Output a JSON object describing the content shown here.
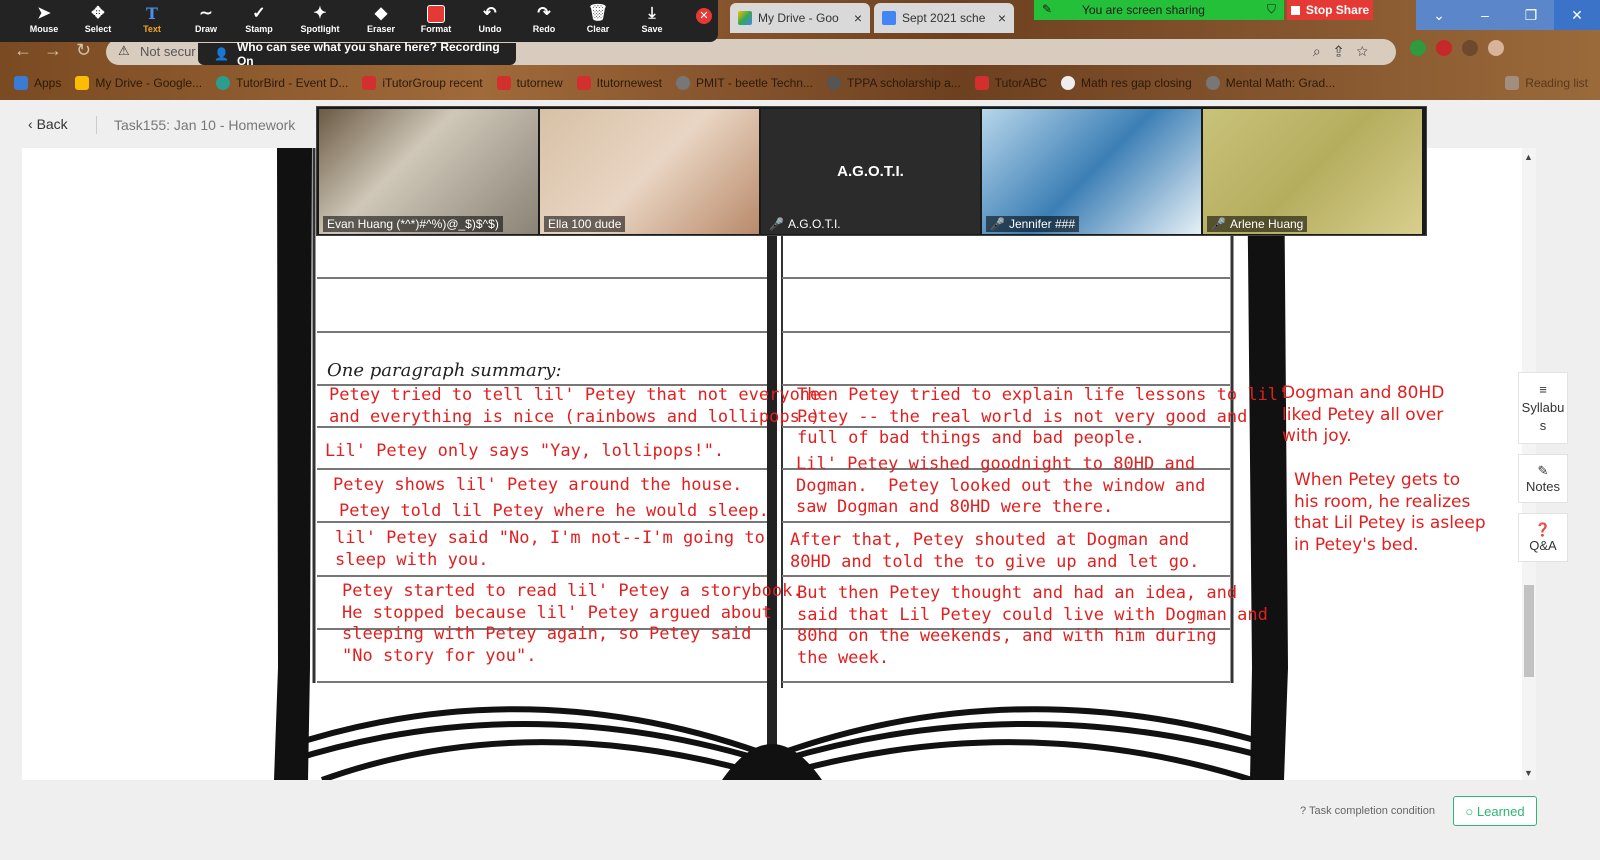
{
  "zoom_toolbar": {
    "tools": [
      {
        "label": "Mouse",
        "icon": "cursor-icon"
      },
      {
        "label": "Select",
        "icon": "move-icon"
      },
      {
        "label": "Text",
        "icon": "text-icon",
        "active": true
      },
      {
        "label": "Draw",
        "icon": "squiggle-icon"
      },
      {
        "label": "Stamp",
        "icon": "check-icon"
      },
      {
        "label": "Spotlight",
        "icon": "wand-icon"
      },
      {
        "label": "Eraser",
        "icon": "eraser-icon"
      },
      {
        "label": "Format",
        "icon": "format-swatch-icon"
      },
      {
        "label": "Undo",
        "icon": "undo-icon"
      },
      {
        "label": "Redo",
        "icon": "redo-icon"
      },
      {
        "label": "Clear",
        "icon": "trash-icon"
      },
      {
        "label": "Save",
        "icon": "save-icon"
      }
    ],
    "recording_notice": "Who can see what you share here? Recording On",
    "sharing_status": "You are screen sharing",
    "stop_share": "Stop Share"
  },
  "browser": {
    "tabs": [
      "My Drive - Goo",
      "Sept 2021 sche"
    ],
    "address_warning": "Not secur",
    "bookmarks": [
      "Apps",
      "My Drive - Google...",
      "TutorBird - Event D...",
      "iTutorGroup recent",
      "tutornew",
      "Itutornewest",
      "PMIT - beetle Techn...",
      "TPPA scholarship a...",
      "TutorABC",
      "Math res gap closing",
      "Mental Math: Grad...",
      "Reading list"
    ]
  },
  "page": {
    "back_label": "Back",
    "breadcrumb": "Task155:  Jan 10 - Homework",
    "side_buttons": [
      {
        "label": "Syllabu\ns",
        "icon": "list-icon"
      },
      {
        "label": "Notes",
        "icon": "pencil-icon"
      },
      {
        "label": "Q&A",
        "icon": "question-icon"
      }
    ],
    "task_condition": "Task completion condition",
    "learned_label": "Learned"
  },
  "video": {
    "participants": [
      "Evan Huang (*^*)#^%)@_$)$^$)",
      "Ella 100 dude",
      "A.G.O.T.I.",
      "Jennifer ###",
      "Arlene Huang"
    ],
    "center_name": "A.G.O.T.I."
  },
  "document": {
    "summary_heading": "One paragraph summary:",
    "left_annotations": [
      "Petey tried to tell lil' Petey that not everyone\nand everything is nice (rainbows and lollipops.)",
      "Lil' Petey only says \"Yay, lollipops!\".",
      "Petey shows lil' Petey around the house.",
      "Petey told lil Petey where he would sleep.",
      "lil' Petey said \"No, I'm not--I'm going to\nsleep with you.",
      "Petey started to read lil' Petey a storybook.\nHe stopped because lil' Petey argued about\nsleeping with Petey again, so Petey said\n\"No story for you\"."
    ],
    "right_annotations": [
      "Then Petey tried to explain life lessons to lil'\nPetey -- the real world is not very good and\nfull of bad things and bad people.",
      "Lil' Petey wished goodnight to 80HD and\nDogman.  Petey looked out the window and\nsaw Dogman and 80HD were there.",
      "After that, Petey shouted at Dogman and\n80HD and told the to give up and let go.",
      "But then Petey thought and had an idea, and\nsaid that Lil Petey could live with Dogman and\n80hd on the weekends, and with him during\nthe week."
    ],
    "margin_annotations": [
      "Dogman and 80HD\nliked Petey all over\nwith joy.",
      "When Petey gets to\nhis room, he realizes\nthat Lil Petey is asleep\nin Petey's bed."
    ]
  },
  "colors": {
    "annotation": "#e02020",
    "accent_green": "#2bb673",
    "toolbar": "#232323"
  }
}
